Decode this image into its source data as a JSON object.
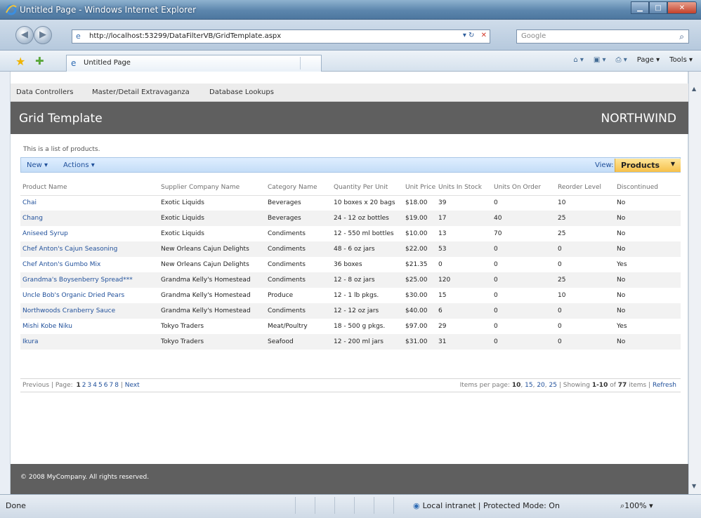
{
  "window": {
    "title": "Untitled Page - Windows Internet Explorer",
    "url": "http://localhost:53299/DataFilterVB/GridTemplate.aspx",
    "search_placeholder": "Google",
    "tab_label": "Untitled Page",
    "tools": {
      "page": "Page",
      "tools": "Tools"
    }
  },
  "menu": {
    "items": [
      "Data Controllers",
      "Master/Detail Extravaganza",
      "Database Lookups"
    ]
  },
  "header": {
    "title": "Grid Template",
    "brand": "NORTHWIND"
  },
  "description": "This is a list of products.",
  "actionbar": {
    "new": "New",
    "actions": "Actions",
    "view_label": "View:",
    "view_value": "Products"
  },
  "grid": {
    "columns": [
      "Product Name",
      "Supplier Company Name",
      "Category Name",
      "Quantity Per Unit",
      "Unit Price",
      "Units In Stock",
      "Units On Order",
      "Reorder Level",
      "Discontinued"
    ],
    "rows": [
      [
        "Chai",
        "Exotic Liquids",
        "Beverages",
        "10 boxes x 20 bags",
        "$18.00",
        "39",
        "0",
        "10",
        "No"
      ],
      [
        "Chang",
        "Exotic Liquids",
        "Beverages",
        "24 - 12 oz bottles",
        "$19.00",
        "17",
        "40",
        "25",
        "No"
      ],
      [
        "Aniseed Syrup",
        "Exotic Liquids",
        "Condiments",
        "12 - 550 ml bottles",
        "$10.00",
        "13",
        "70",
        "25",
        "No"
      ],
      [
        "Chef Anton's Cajun Seasoning",
        "New Orleans Cajun Delights",
        "Condiments",
        "48 - 6 oz jars",
        "$22.00",
        "53",
        "0",
        "0",
        "No"
      ],
      [
        "Chef Anton's Gumbo Mix",
        "New Orleans Cajun Delights",
        "Condiments",
        "36 boxes",
        "$21.35",
        "0",
        "0",
        "0",
        "Yes"
      ],
      [
        "Grandma's Boysenberry Spread***",
        "Grandma Kelly's Homestead",
        "Condiments",
        "12 - 8 oz jars",
        "$25.00",
        "120",
        "0",
        "25",
        "No"
      ],
      [
        "Uncle Bob's Organic Dried Pears",
        "Grandma Kelly's Homestead",
        "Produce",
        "12 - 1 lb pkgs.",
        "$30.00",
        "15",
        "0",
        "10",
        "No"
      ],
      [
        "Northwoods Cranberry Sauce",
        "Grandma Kelly's Homestead",
        "Condiments",
        "12 - 12 oz jars",
        "$40.00",
        "6",
        "0",
        "0",
        "No"
      ],
      [
        "Mishi Kobe Niku",
        "Tokyo Traders",
        "Meat/Poultry",
        "18 - 500 g pkgs.",
        "$97.00",
        "29",
        "0",
        "0",
        "Yes"
      ],
      [
        "Ikura",
        "Tokyo Traders",
        "Seafood",
        "12 - 200 ml jars",
        "$31.00",
        "31",
        "0",
        "0",
        "No"
      ]
    ]
  },
  "pager": {
    "previous": "Previous",
    "page_label": "Page:",
    "pages": [
      "1",
      "2",
      "3",
      "4",
      "5",
      "6",
      "7",
      "8"
    ],
    "current": "1",
    "next": "Next",
    "items_per_page_label": "Items per page:",
    "sizes": [
      "10",
      "15",
      "20",
      "25"
    ],
    "showing_prefix": "Showing",
    "showing_range": "1-10",
    "showing_of": "of",
    "total": "77",
    "items_label": "items",
    "refresh": "Refresh"
  },
  "footer": {
    "copyright": "© 2008 MyCompany. All rights reserved."
  },
  "status": {
    "left": "Done",
    "zone": "Local intranet | Protected Mode: On",
    "zoom": "100%"
  }
}
